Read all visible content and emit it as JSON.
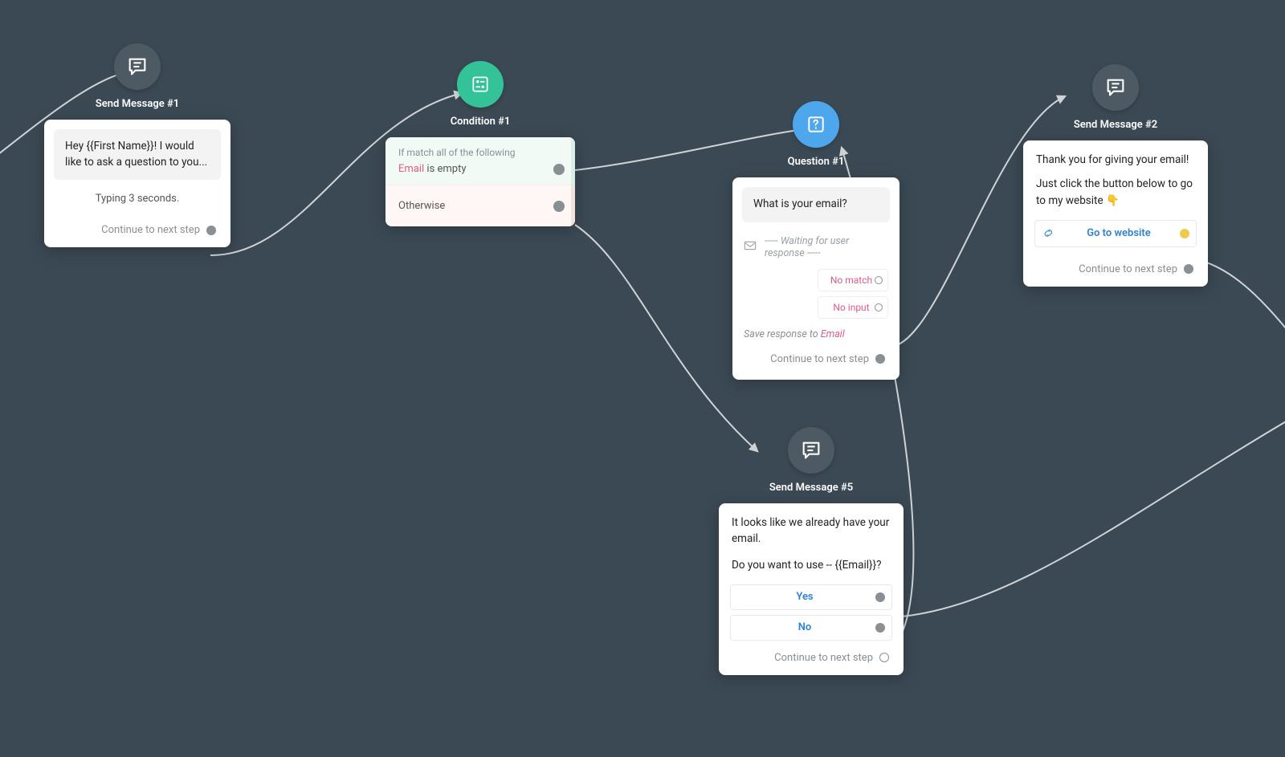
{
  "nodes": {
    "send1": {
      "title": "Send Message #1",
      "message": "Hey {{First Name}}! I would like to ask a question to you...",
      "typing": "Typing 3 seconds.",
      "continue": "Continue to next step"
    },
    "condition1": {
      "title": "Condition #1",
      "if_header": "If match all of the following",
      "field": "Email",
      "predicate": "is empty",
      "otherwise": "Otherwise"
    },
    "question1": {
      "title": "Question #1",
      "prompt": "What is your email?",
      "waiting": "-----  Waiting for user response  -----",
      "no_match": "No match",
      "no_input": "No input",
      "save_prefix": "Save response to",
      "save_field": "Email",
      "continue": "Continue to next step"
    },
    "send2": {
      "title": "Send Message #2",
      "line1": "Thank you for giving your email!",
      "line2": "Just click the button below to go to my website 👇",
      "button": "Go to website",
      "continue": "Continue to next step"
    },
    "send5": {
      "title": "Send Message #5",
      "line1": "It looks like we already have your email.",
      "line2": "Do you want to use -- {{Email}}?",
      "yes": "Yes",
      "no": "No",
      "continue": "Continue to next step"
    }
  },
  "colors": {
    "gray": "#4d5a64",
    "green": "#34c298",
    "blue": "#4ea7ec",
    "accent_pink": "#e05a86",
    "link_blue": "#2e82d6"
  }
}
